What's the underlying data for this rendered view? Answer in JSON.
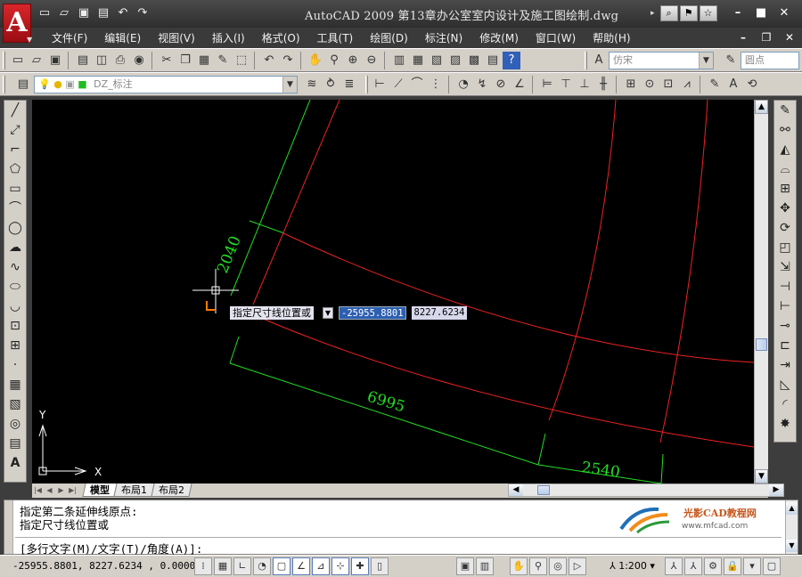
{
  "titlebar": {
    "title": "AutoCAD 2009  第13章办公室室内设计及施工图绘制.dwg",
    "app_logo": "A",
    "quick_access": [
      "new-icon",
      "open-icon",
      "save-icon",
      "print-icon",
      "undo-icon",
      "redo-icon"
    ],
    "search_buttons": [
      "binoculars-icon",
      "communication-icon",
      "favorites-icon"
    ],
    "window_controls": [
      "minimize-icon",
      "restore-icon",
      "close-icon"
    ]
  },
  "menu": {
    "items": [
      "文件(F)",
      "编辑(E)",
      "视图(V)",
      "插入(I)",
      "格式(O)",
      "工具(T)",
      "绘图(D)",
      "标注(N)",
      "修改(M)",
      "窗口(W)",
      "帮助(H)"
    ],
    "doc_controls": [
      "doc-minimize-icon",
      "doc-restore-icon",
      "doc-close-icon"
    ]
  },
  "toolbar1": {
    "text_style": "仿宋",
    "dim_style": "圆点"
  },
  "toolbar2": {
    "layer": "DZ_标注"
  },
  "drawing": {
    "dimensions": [
      "2040",
      "6995",
      "2540"
    ],
    "dynamic_input": {
      "prompt": "指定尺寸线位置或",
      "x_value": "-25955.8801",
      "y_value": "8227.6234"
    },
    "ucs": {
      "x_label": "X",
      "y_label": "Y"
    },
    "colors": {
      "dimension": "#22dd22",
      "wall": "#ee2222",
      "crosshair": "#ffffff",
      "background": "#000000"
    }
  },
  "tabs": {
    "items": [
      "模型",
      "布局1",
      "布局2"
    ],
    "active": "模型"
  },
  "command": {
    "history": [
      "指定第二条延伸线原点:",
      "指定尺寸线位置或"
    ],
    "current": "[多行文字(M)/文字(T)/角度(A)]:",
    "logo_brand": "光影CAD教程网",
    "logo_url": "www.mfcad.com"
  },
  "status": {
    "coords": "-25955.8801,  8227.6234 ,  0.0000",
    "scale": "1:200"
  }
}
